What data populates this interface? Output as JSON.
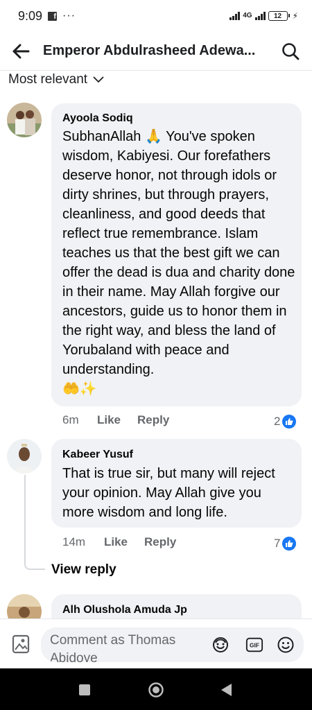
{
  "status_bar": {
    "time": "9:09",
    "dots": "···",
    "network": "4G",
    "battery": "12"
  },
  "header": {
    "title": "Emperor Abdulrasheed Adewa..."
  },
  "sort": {
    "label": "Most relevant"
  },
  "comments": [
    {
      "author": "Ayoola Sodiq",
      "text": "SubhanAllah 🙏 You've spoken wisdom, Kabiyesi. Our forefathers deserve honor, not through idols or dirty shrines, but through prayers, cleanliness, and good deeds that reflect true remembrance. Islam teaches us that the best gift we can offer the dead is dua and charity done in their name. May Allah forgive our ancestors, guide us to honor them in the right way, and bless the land of Yorubaland with peace and understanding.",
      "emoji_line": "🤲✨",
      "time": "6m",
      "like_label": "Like",
      "reply_label": "Reply",
      "reactions": "2"
    },
    {
      "author": "Kabeer Yusuf",
      "text": "That is true sir, but many will reject your opinion. May Allah give you more wisdom and long life.",
      "time": "14m",
      "like_label": "Like",
      "reply_label": "Reply",
      "reactions": "7"
    },
    {
      "author": "Alh Olushola Amuda Jp"
    }
  ],
  "view_reply": "View reply",
  "composer": {
    "placeholder": "Comment as Thomas Abidoye"
  },
  "colors": {
    "accent": "#1877f2",
    "bubble": "#f0f2f5",
    "secondary_text": "#65676b"
  }
}
